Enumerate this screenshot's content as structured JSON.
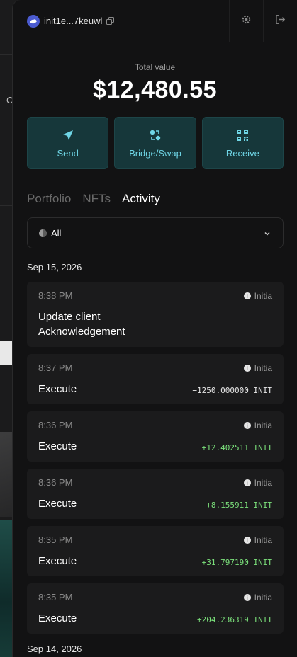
{
  "header": {
    "address": "init1e...7keuwl"
  },
  "balance": {
    "label": "Total value",
    "value": "$12,480.55"
  },
  "actions": [
    {
      "label": "Send",
      "icon": "send-icon"
    },
    {
      "label": "Bridge/Swap",
      "icon": "bridge-icon"
    },
    {
      "label": "Receive",
      "icon": "qr-code-icon"
    }
  ],
  "tabs": [
    {
      "label": "Portfolio",
      "active": false
    },
    {
      "label": "NFTs",
      "active": false
    },
    {
      "label": "Activity",
      "active": true
    }
  ],
  "filter": {
    "selected": "All"
  },
  "activity": {
    "groups": [
      {
        "date": "Sep 15, 2026",
        "items": [
          {
            "time": "8:38 PM",
            "chain": "Initia",
            "title_line1": "Update client",
            "title_line2": "Acknowledgement",
            "amount": ""
          },
          {
            "time": "8:37 PM",
            "chain": "Initia",
            "title": "Execute",
            "amount": "−1250.000000 INIT"
          },
          {
            "time": "8:36 PM",
            "chain": "Initia",
            "title": "Execute",
            "amount": "+12.402511 INIT"
          },
          {
            "time": "8:36 PM",
            "chain": "Initia",
            "title": "Execute",
            "amount": "+8.155911 INIT"
          },
          {
            "time": "8:35 PM",
            "chain": "Initia",
            "title": "Execute",
            "amount": "+31.797190 INIT"
          },
          {
            "time": "8:35 PM",
            "chain": "Initia",
            "title": "Execute",
            "amount": "+204.236319 INIT"
          }
        ]
      },
      {
        "date": "Sep 14, 2026"
      }
    ]
  },
  "background_app": {
    "partial_letter": "C"
  },
  "colors": {
    "accent": "#6fd6e6",
    "positive": "#7be07b",
    "action_bg": "#16373a"
  }
}
